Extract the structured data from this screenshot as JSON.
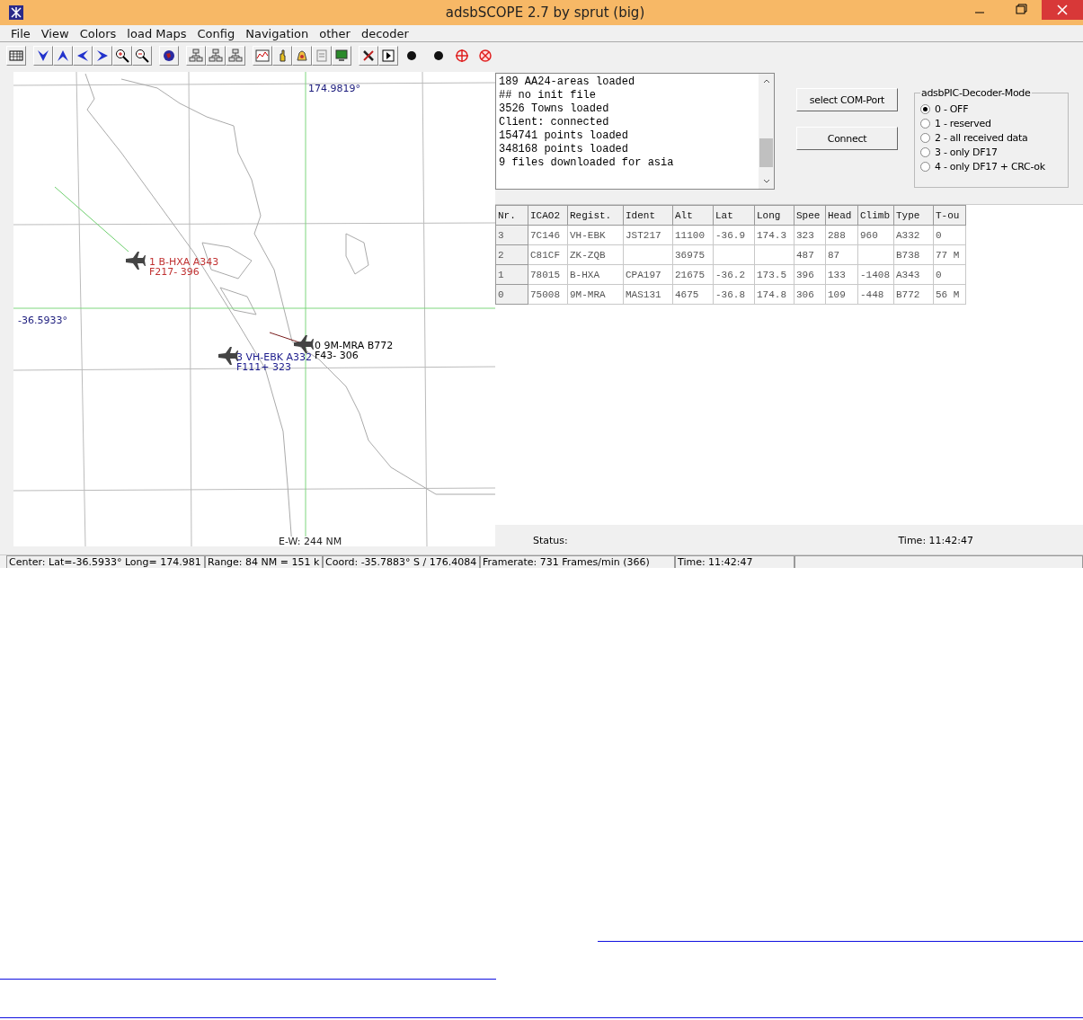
{
  "window": {
    "title": "adsbSCOPE 2.7 by sprut  (big)"
  },
  "menu": [
    "File",
    "View",
    "Colors",
    "load Maps",
    "Config",
    "Navigation",
    "other",
    "decoder"
  ],
  "map": {
    "lon_label": "174.9819°",
    "lat_label": "-36.5933°",
    "scale_label": "E-W: 244 NM",
    "aircraft": [
      {
        "line1": "1 B-HXA  A343",
        "line2": "F217- 396",
        "color": "#c03030"
      },
      {
        "line1": "3 VH-EBK A332",
        "line2": "F111+ 323",
        "color": "#1a1a8c"
      },
      {
        "line1": "0 9M-MRA  B772",
        "line2": "F43- 306",
        "color": "#000000"
      }
    ]
  },
  "log": [
    "189 AA24-areas loaded",
    "## no init file",
    "3526 Towns loaded",
    "Client: connected",
    "154741 points loaded",
    "348168 points loaded",
    "9 files downloaded for asia"
  ],
  "buttons": [
    "select COM-Port",
    "Connect"
  ],
  "decoder_mode": {
    "title": "adsbPIC-Decoder-Mode",
    "options": [
      {
        "label": "0 - OFF",
        "selected": true
      },
      {
        "label": "1 - reserved",
        "selected": false
      },
      {
        "label": "2 - all received data",
        "selected": false
      },
      {
        "label": "3 - only DF17",
        "selected": false
      },
      {
        "label": "4 - only DF17 + CRC-ok",
        "selected": false
      }
    ]
  },
  "table": {
    "columns": [
      "Nr.",
      "ICAO2",
      "Regist.",
      "Ident",
      "Alt",
      "Lat",
      "Long",
      "Spee",
      "Head",
      "Climb",
      "Type",
      "T-ou"
    ],
    "rows": [
      [
        "3",
        "7C146",
        "VH-EBK",
        "JST217",
        "11100",
        "-36.9",
        "174.3",
        "323",
        "288",
        "960",
        "A332",
        "0"
      ],
      [
        "2",
        "C81CF",
        "ZK-ZQB",
        "",
        "36975",
        "",
        "",
        "487",
        "87",
        "",
        "B738",
        "77 M"
      ],
      [
        "1",
        "78015",
        "B-HXA",
        "CPA197",
        "21675",
        "-36.2",
        "173.5",
        "396",
        "133",
        "-1408",
        "A343",
        "0"
      ],
      [
        "0",
        "75008",
        "9M-MRA",
        "MAS131",
        "4675",
        "-36.8",
        "174.8",
        "306",
        "109",
        "-448",
        "B772",
        "56 M"
      ]
    ]
  },
  "info": {
    "status": "Status:",
    "time": "Time: 11:42:47"
  },
  "status_bar": [
    "Center: Lat=-36.5933° Long= 174.981",
    "Range: 84 NM = 151 k",
    "Coord: -35.7883° S / 176.4084",
    "Framerate:  731 Frames/min (366)",
    "Time: 11:42:47"
  ]
}
